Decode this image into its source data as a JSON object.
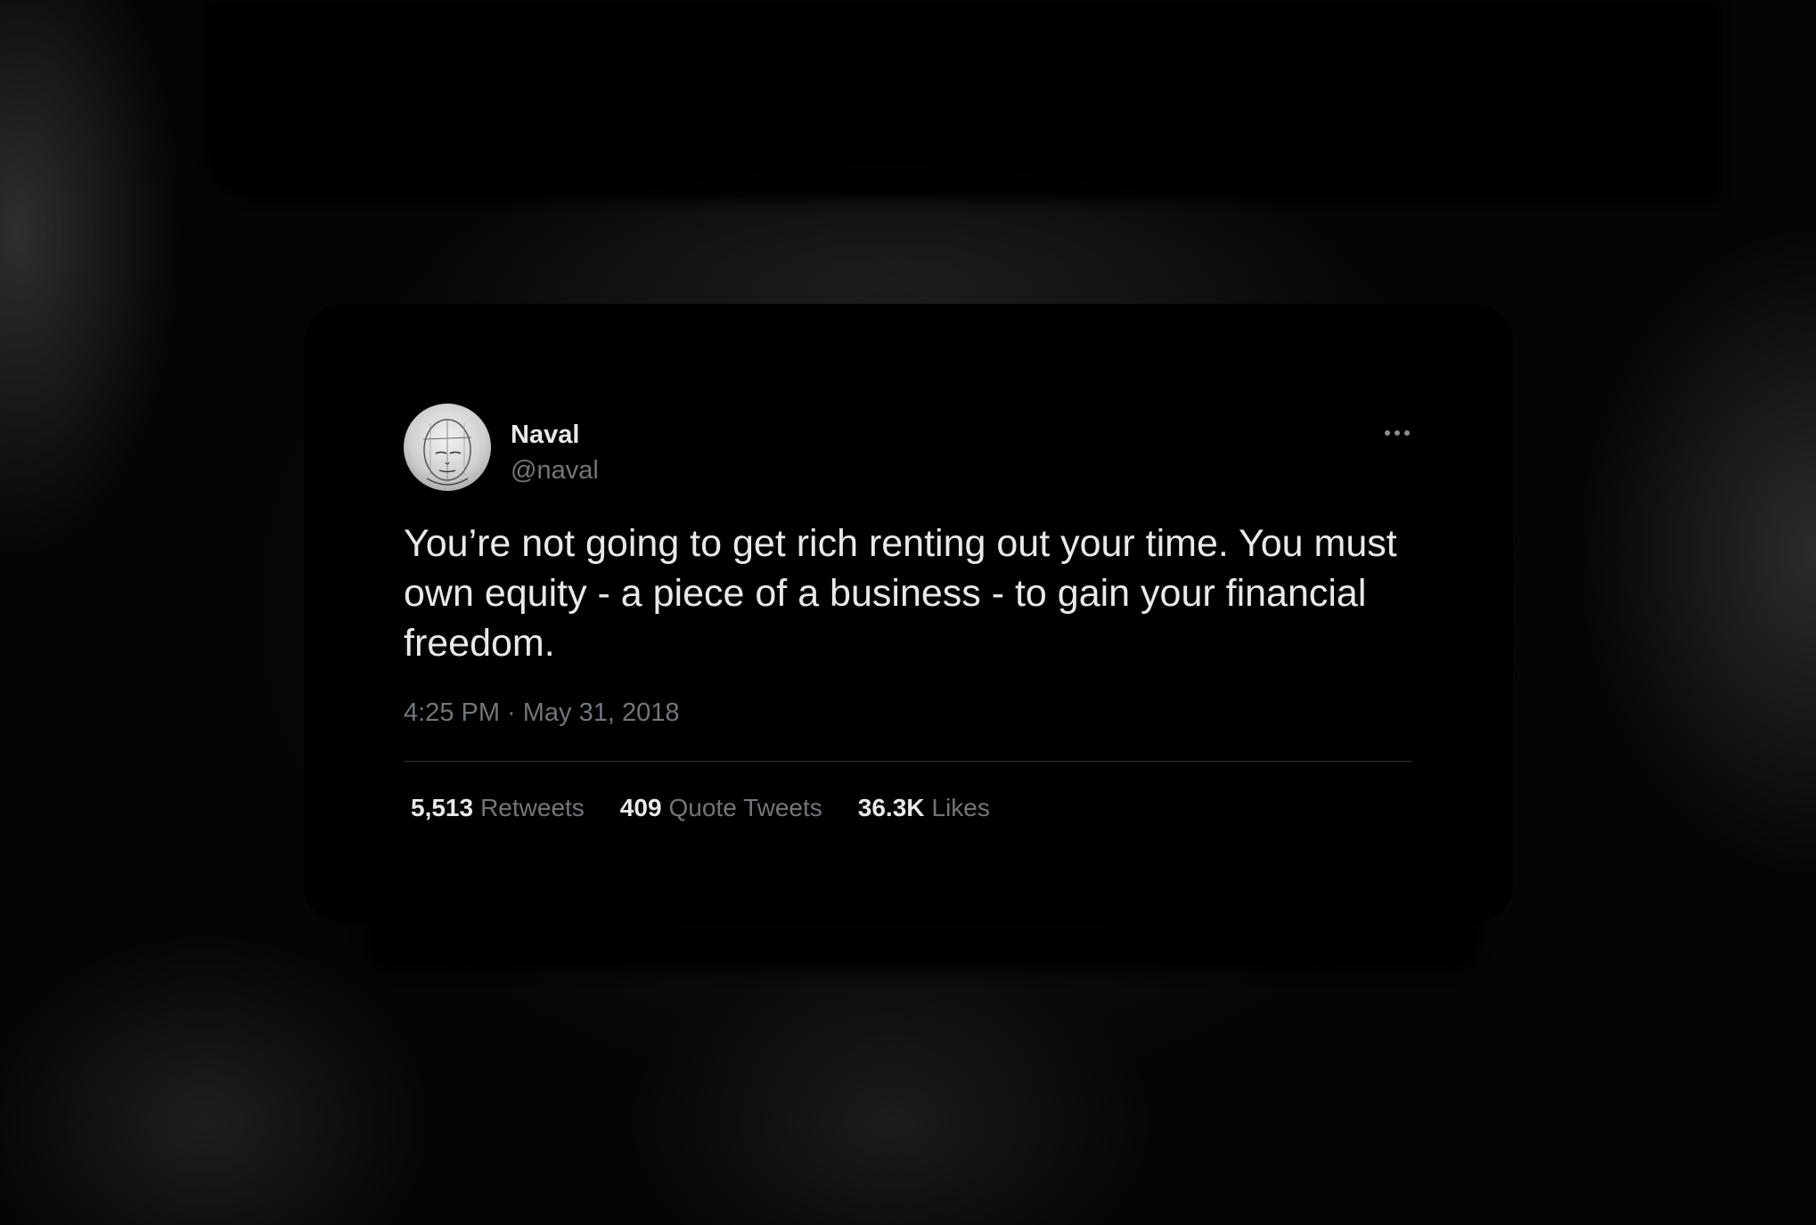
{
  "tweet": {
    "author": {
      "name": "Naval",
      "handle": "@naval",
      "avatar": "avatar"
    },
    "more_icon": "more-horizontal-icon",
    "text": "You’re not going to get rich renting out your time. You must own equity - a piece of a business - to gain your financial freedom.",
    "timestamp": "4:25 PM · May 31, 2018",
    "stats": [
      {
        "count": "5,513",
        "label": "Retweets"
      },
      {
        "count": "409",
        "label": "Quote Tweets"
      },
      {
        "count": "36.3K",
        "label": "Likes"
      }
    ]
  },
  "colors": {
    "card_background": "#000000",
    "primary_text": "#e7e9ea",
    "secondary_text": "#71767b",
    "divider": "#2f3336"
  }
}
